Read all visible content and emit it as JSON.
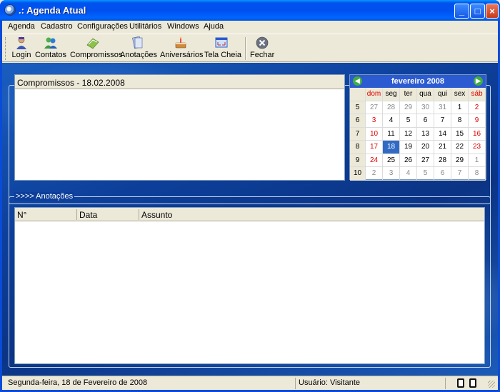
{
  "window": {
    "title": ".: Agenda Atual",
    "minimize": "_",
    "maximize": "□",
    "close": "×"
  },
  "menu": [
    "Agenda",
    "Cadastro",
    "Configurações",
    "Utilitários",
    "Windows",
    "Ajuda"
  ],
  "toolbar": {
    "login": "Login",
    "contatos": "Contatos",
    "compromissos": "Compromissos",
    "anotacoes": "Anotações",
    "aniversarios": "Aniversários",
    "tela_cheia": "Tela Cheia",
    "fechar": "Fechar"
  },
  "compromissos": {
    "header": "Compromissos  -  18.02.2008"
  },
  "calendar": {
    "month_label": "fevereiro   2008",
    "prev": "◀",
    "next": "▶",
    "dow": [
      "dom",
      "seg",
      "ter",
      "qua",
      "qui",
      "sex",
      "sáb"
    ],
    "weeks": [
      {
        "num": "5",
        "days": [
          "27",
          "28",
          "29",
          "30",
          "31",
          "1",
          "2"
        ]
      },
      {
        "num": "6",
        "days": [
          "3",
          "4",
          "5",
          "6",
          "7",
          "8",
          "9"
        ]
      },
      {
        "num": "7",
        "days": [
          "10",
          "11",
          "12",
          "13",
          "14",
          "15",
          "16"
        ]
      },
      {
        "num": "8",
        "days": [
          "17",
          "18",
          "19",
          "20",
          "21",
          "22",
          "23"
        ]
      },
      {
        "num": "9",
        "days": [
          "24",
          "25",
          "26",
          "27",
          "28",
          "29",
          "1"
        ]
      },
      {
        "num": "10",
        "days": [
          "2",
          "3",
          "4",
          "5",
          "6",
          "7",
          "8"
        ]
      }
    ],
    "selected": "18"
  },
  "anotacoes": {
    "legend": ">>>> Anotações",
    "columns": [
      "N°",
      "Data",
      "Assunto"
    ]
  },
  "status": {
    "date": "Segunda-feira, 18 de Fevereiro de 2008",
    "user": "Usuário: Visitante"
  }
}
